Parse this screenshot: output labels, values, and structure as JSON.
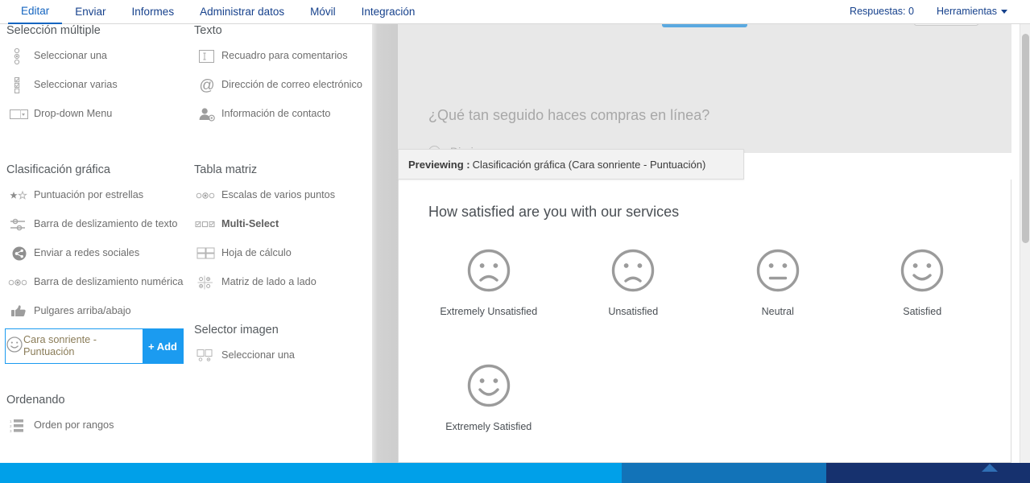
{
  "nav": {
    "left_items": [
      {
        "label": "Editar",
        "active": true
      },
      {
        "label": "Enviar",
        "active": false
      },
      {
        "label": "Informes",
        "active": false
      },
      {
        "label": "Administrar datos",
        "active": false
      },
      {
        "label": "Móvil",
        "active": false
      },
      {
        "label": "Integración",
        "active": false
      }
    ],
    "responses_label": "Respuestas: 0",
    "tools_label": "Herramientas"
  },
  "palette": {
    "groups": [
      {
        "id": "seleccion-multiple",
        "title": "Selección múltiple",
        "column": "a",
        "items": [
          {
            "label": "Seleccionar una",
            "icon": "radio-list-icon"
          },
          {
            "label": "Seleccionar varias",
            "icon": "checkbox-list-icon"
          },
          {
            "label": "Drop-down Menu",
            "icon": "dropdown-icon"
          }
        ]
      },
      {
        "id": "clasificacion-grafica",
        "title": "Clasificación gráfica",
        "column": "a",
        "items": [
          {
            "label": "Puntuación por estrellas",
            "icon": "stars-icon"
          },
          {
            "label": "Barra de deslizamiento de texto",
            "icon": "text-slider-icon"
          },
          {
            "label": "Enviar a redes sociales",
            "icon": "share-icon"
          },
          {
            "label": "Barra de deslizamiento numérica",
            "icon": "numeric-slider-icon"
          },
          {
            "label": "Pulgares arriba/abajo",
            "icon": "thumbs-icon"
          }
        ],
        "selected_item": {
          "label": "Cara sonriente - Puntuación",
          "icon": "smiley-icon",
          "add_label": "+ Add"
        }
      },
      {
        "id": "ordenando",
        "title": "Ordenando",
        "column": "a",
        "items": [
          {
            "label": "Orden por rangos",
            "icon": "ranking-icon"
          }
        ]
      },
      {
        "id": "texto",
        "title": "Texto",
        "column": "b",
        "items": [
          {
            "label": "Recuadro para comentarios",
            "icon": "textbox-icon"
          },
          {
            "label": "Dirección de correo electrónico",
            "icon": "at-icon"
          },
          {
            "label": "Información de contacto",
            "icon": "contact-icon"
          }
        ]
      },
      {
        "id": "tabla-matriz",
        "title": "Tabla matriz",
        "column": "b",
        "items": [
          {
            "label": "Escalas de varios puntos",
            "icon": "scale-icon"
          },
          {
            "label": "Multi-Select",
            "icon": "multiselect-icon",
            "bold": true
          },
          {
            "label": "Hoja de cálculo",
            "icon": "spreadsheet-icon"
          },
          {
            "label": "Matriz de lado a lado",
            "icon": "side-by-side-matrix-icon"
          }
        ]
      },
      {
        "id": "selector-imagen",
        "title": "Selector imagen",
        "column": "b",
        "items": [
          {
            "label": "Seleccionar una",
            "icon": "image-select-icon"
          }
        ]
      }
    ]
  },
  "survey": {
    "question": "¿Qué tan seguido haces compras en línea?",
    "option": "Diario"
  },
  "preview": {
    "bar_key": "Previewing :",
    "bar_value": "Clasificación gráfica (Cara sonriente - Puntuación)",
    "title": "How satisfied are you with our services",
    "options": [
      {
        "label": "Extremely Unsatisfied",
        "face": "very-sad"
      },
      {
        "label": "Unsatisfied",
        "face": "sad"
      },
      {
        "label": "Neutral",
        "face": "neutral"
      },
      {
        "label": "Satisfied",
        "face": "happy"
      },
      {
        "label": "Extremely Satisfied",
        "face": "very-happy"
      }
    ]
  },
  "colors": {
    "accent_blue": "#1b9bf0",
    "nav_blue": "#16418c",
    "footer_cyan": "#00a0e9",
    "footer_mid": "#1273b8",
    "footer_navy": "#16316e",
    "face_grey": "#9b9b9b"
  }
}
